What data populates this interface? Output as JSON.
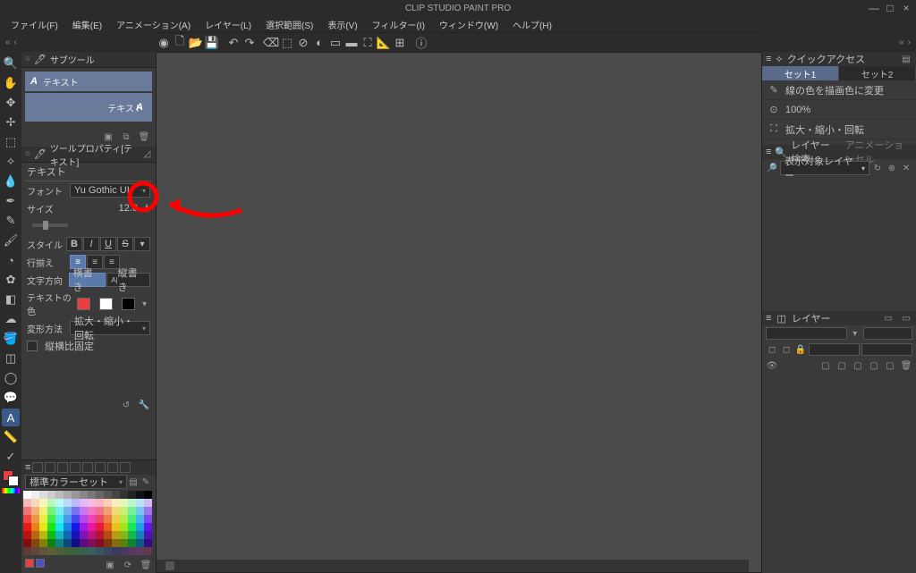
{
  "app_title": "CLIP STUDIO PAINT PRO",
  "menu": [
    "ファイル(F)",
    "編集(E)",
    "アニメーション(A)",
    "レイヤー(L)",
    "選択範囲(S)",
    "表示(V)",
    "フィルター(I)",
    "ウィンドウ(W)",
    "ヘルプ(H)"
  ],
  "subtool": {
    "header": "サブツール",
    "item1": "テキスト",
    "item2": "テキスト",
    "icon_letter": "A"
  },
  "toolprop": {
    "header": "ツールプロパティ[テキスト]",
    "title": "テキスト",
    "font_label": "フォント",
    "font_value": "Yu Gothic UI",
    "size_label": "サイズ",
    "size_value": "12.0",
    "style_label": "スタイル",
    "align_label": "行揃え",
    "dir_label": "文字方向",
    "dir_h": "横書き",
    "dir_v": "縦書き",
    "textcolor_label": "テキストの色",
    "transform_label": "変形方法",
    "transform_value": "拡大・縮小・回転",
    "lock_label": "縦横比固定"
  },
  "palette": {
    "header": "標準カラーセット"
  },
  "quick": {
    "header": "クイックアクセス",
    "tab1": "セット1",
    "tab2": "セット2",
    "item1": "線の色を描画色に変更",
    "item2": "100%",
    "item3": "拡大・縮小・回転"
  },
  "layersearch": {
    "tab1": "レイヤー検索",
    "tab2": "アニメーションセル",
    "placeholder": "表示対象レイヤー"
  },
  "layers": {
    "header": "レイヤー"
  }
}
